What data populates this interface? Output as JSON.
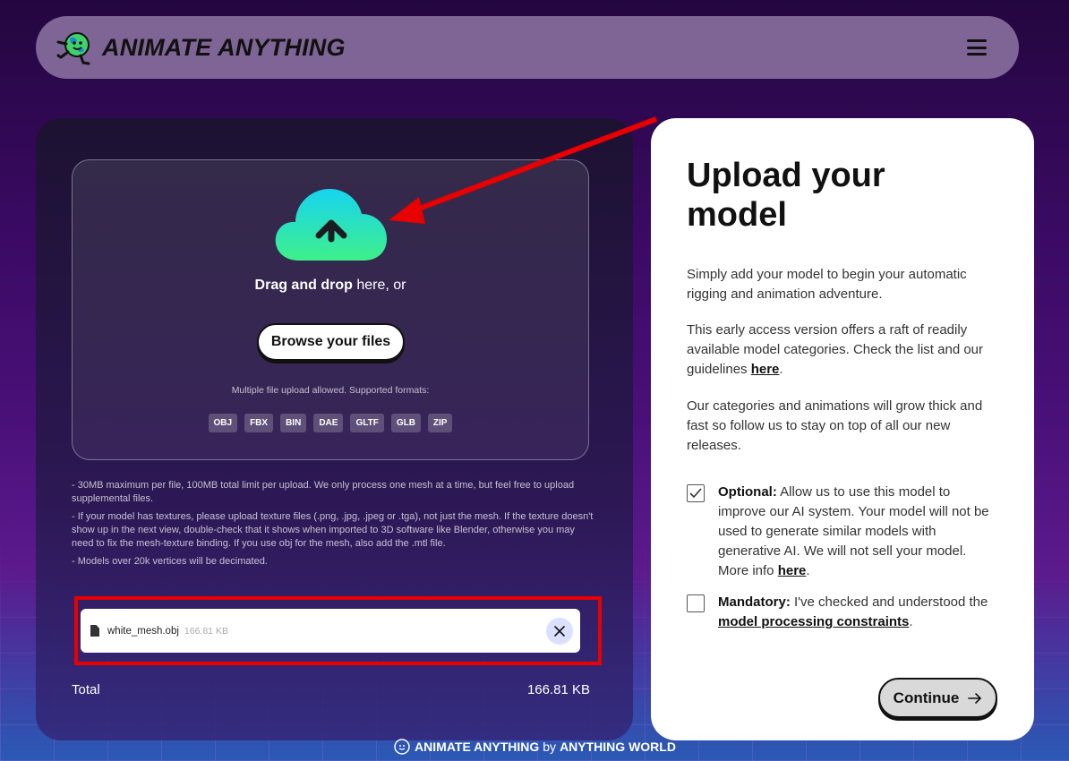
{
  "header": {
    "logo_text": "ANIMATE ANYTHING"
  },
  "upload": {
    "drag_bold": "Drag and drop",
    "drag_rest": " here, or",
    "browse_label": "Browse your files",
    "formats_note": "Multiple file upload allowed. Supported formats:",
    "formats": [
      "OBJ",
      "FBX",
      "BIN",
      "DAE",
      "GLTF",
      "GLB",
      "ZIP"
    ]
  },
  "notes": [
    "- 30MB maximum per file, 100MB total limit per upload. We only process one mesh at a time, but feel free to upload supplemental files.",
    "- If your model has textures, please upload texture files (.png, .jpg, .jpeg or .tga), not just the mesh. If the texture doesn't show up in the next view, double-check that it shows when imported to 3D software like Blender, otherwise you may need to fix the mesh-texture binding. If you use obj for the mesh, also add the .mtl file.",
    "- Models over 20k vertices will be decimated."
  ],
  "file": {
    "name": "white_mesh.obj",
    "size": "166.81 KB"
  },
  "total": {
    "label": "Total",
    "value": "166.81 KB"
  },
  "panel": {
    "title": "Upload your model",
    "para1": "Simply add your model to begin your automatic rigging and animation adventure.",
    "para2_text": "This early access version offers a raft of readily available model categories. Check the list and our guidelines ",
    "para2_link": "here",
    "para2_end": ".",
    "para3": "Our categories and animations will grow thick and fast so follow us to stay on top of all our new releases.",
    "optional_label": "Optional:",
    "optional_text": " Allow us to use this model to improve our AI system. Your model will not be used to generate similar models with generative AI. We will not sell your model. More info ",
    "optional_link": "here",
    "optional_end": ".",
    "optional_checked": true,
    "mandatory_label": "Mandatory:",
    "mandatory_text": " I've checked and understood the ",
    "mandatory_link": "model processing constraints",
    "mandatory_end": ".",
    "mandatory_checked": false,
    "continue_label": "Continue"
  },
  "footer": {
    "brand": "ANIMATE ANYTHING",
    "by": "by",
    "company": "ANYTHING WORLD"
  },
  "colors": {
    "annotation_red": "#e80000",
    "cloud_top": "#17d4f0",
    "cloud_bottom": "#3ef08a"
  }
}
